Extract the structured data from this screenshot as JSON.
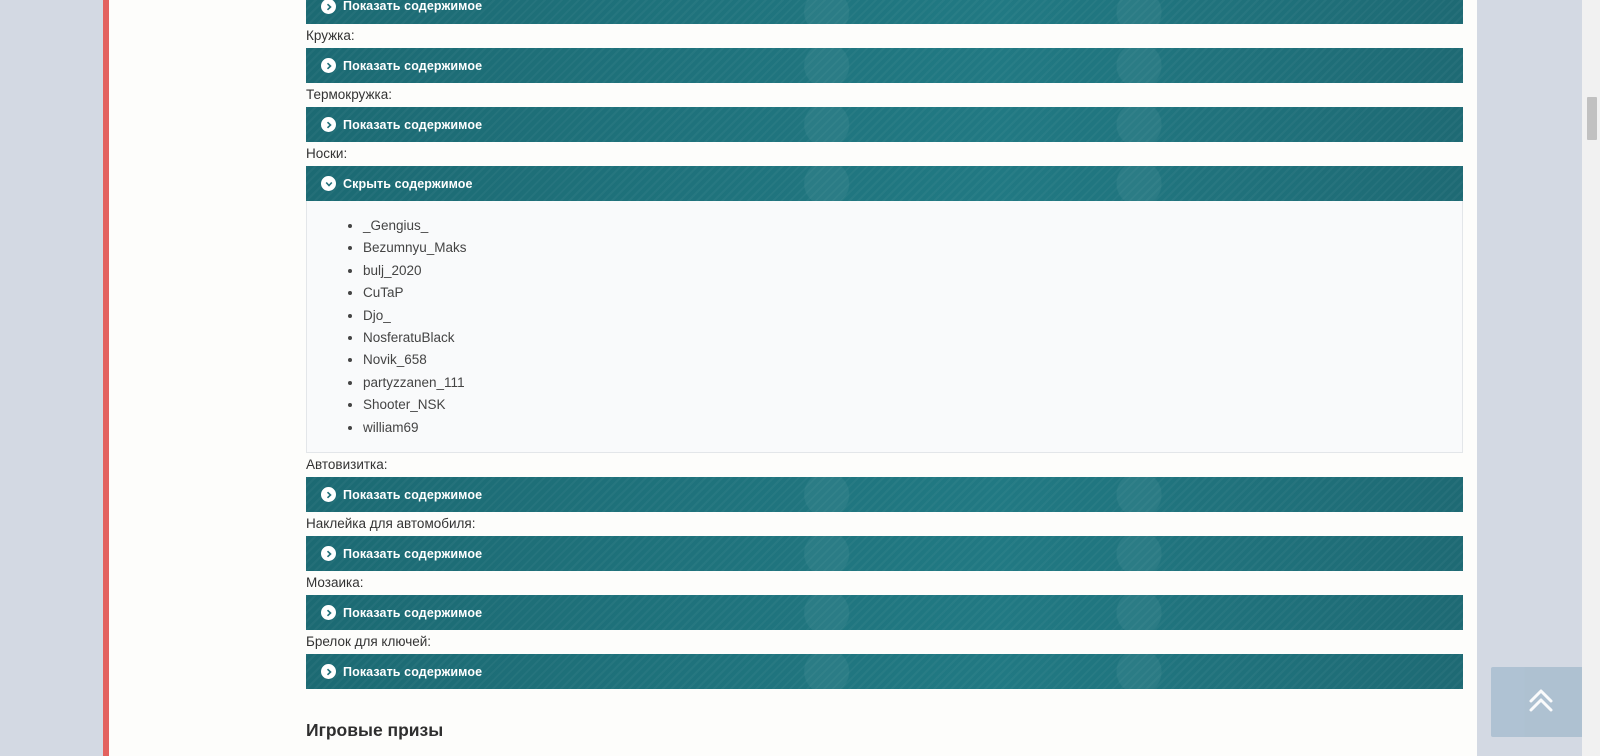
{
  "spoiler": {
    "show_label": "Показать содержимое",
    "hide_label": "Скрыть содержимое"
  },
  "items": [
    {
      "label": "Кружка:"
    },
    {
      "label": "Термокружка:"
    },
    {
      "label": "Носки:"
    },
    {
      "label": "Автовизитка:"
    },
    {
      "label": "Наклейка для автомобиля:"
    },
    {
      "label": "Мозаика:"
    },
    {
      "label": "Брелок для ключей:"
    }
  ],
  "socks_winners": [
    "_Gengius_",
    "Bezumnyu_Maks",
    "bulj_2020",
    "CuTaP",
    "Djo_",
    "NosferatuBlack",
    "Novik_658",
    "partyzzanen_111",
    "Shooter_NSK",
    "william69"
  ],
  "section_title": "Игровые призы",
  "icons": {
    "chevron_right": "chevron-right-icon",
    "chevron_down": "chevron-down-icon",
    "back_to_top": "double-chevron-up-icon"
  },
  "colors": {
    "accent": "#e3625f",
    "spoiler_head": "#1f6e78",
    "back_to_top": "#abbfd0"
  }
}
